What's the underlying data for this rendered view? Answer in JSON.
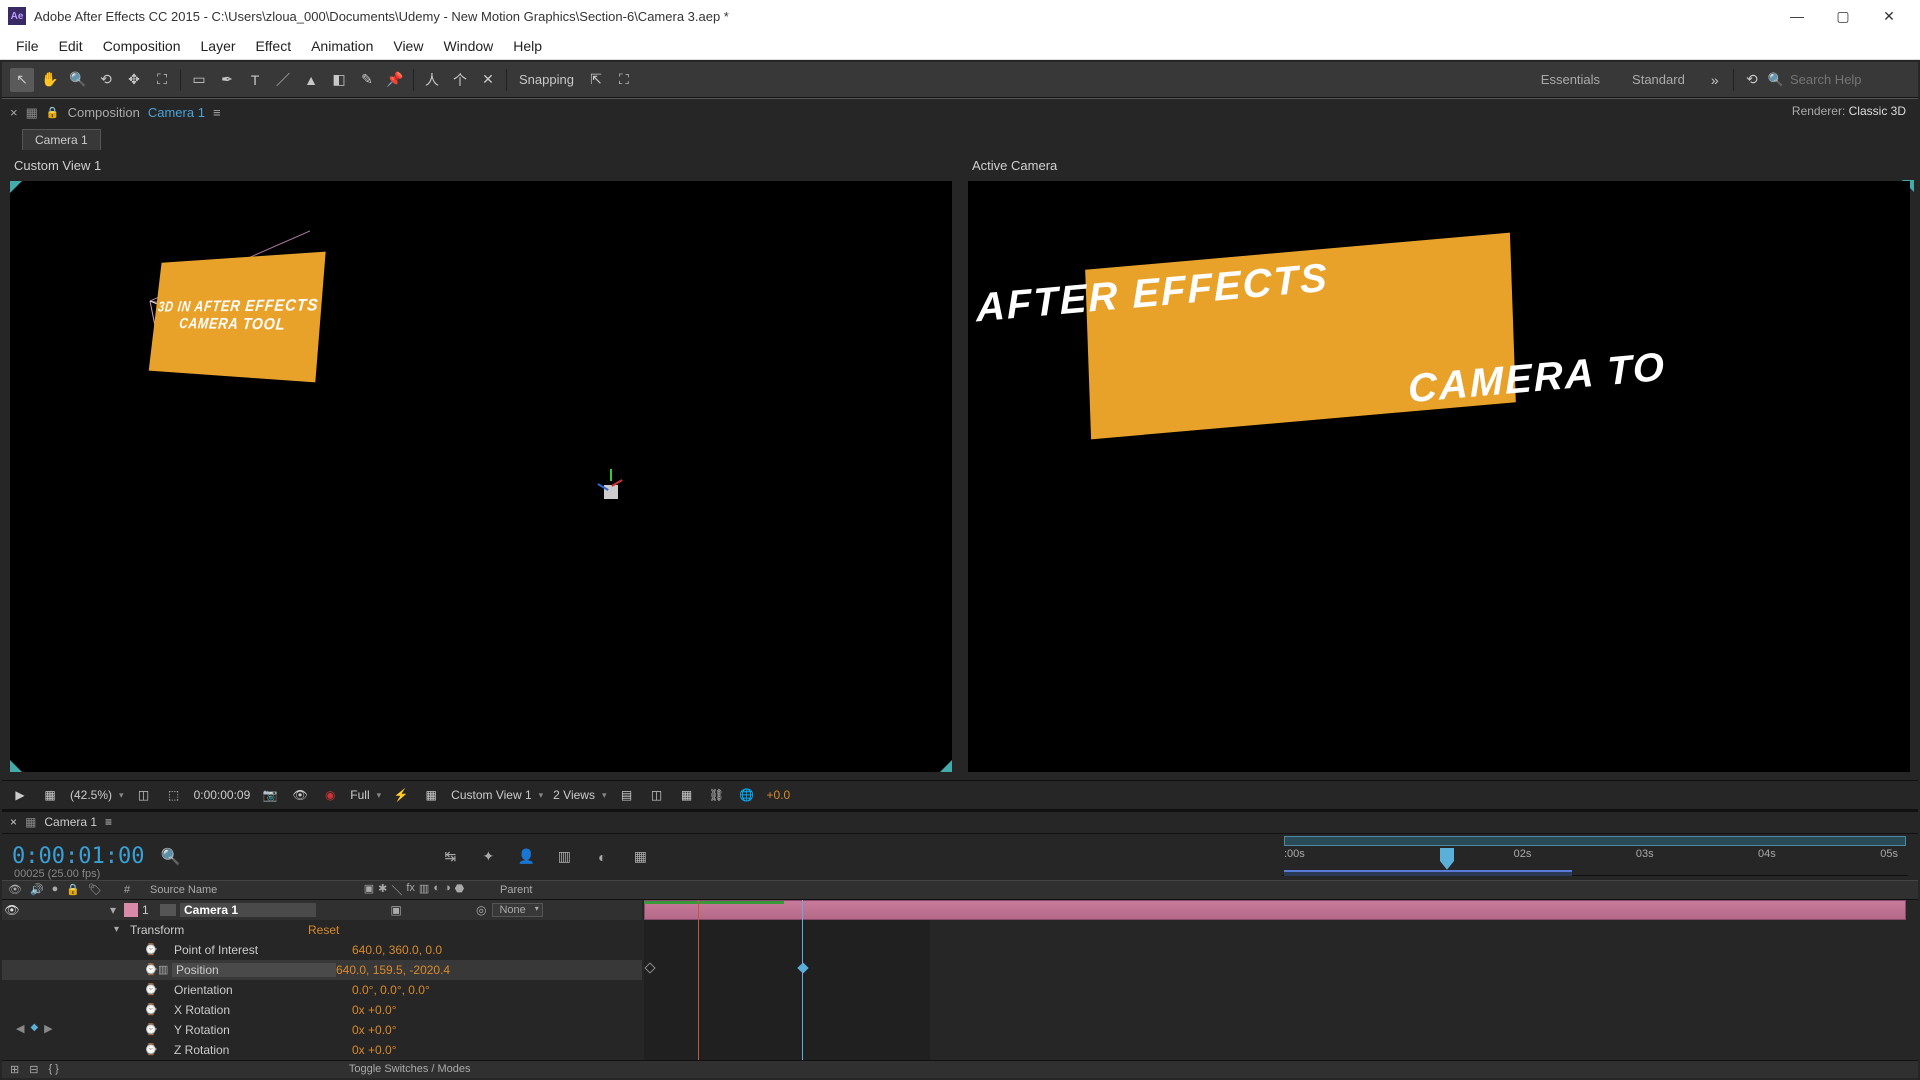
{
  "title": "Adobe After Effects CC 2015 - C:\\Users\\zloua_000\\Documents\\Udemy - New Motion Graphics\\Section-6\\Camera 3.aep *",
  "menu": [
    "File",
    "Edit",
    "Composition",
    "Layer",
    "Effect",
    "Animation",
    "View",
    "Window",
    "Help"
  ],
  "toolbar": {
    "snapping": "Snapping"
  },
  "workspaces": [
    "Essentials",
    "Standard"
  ],
  "search": {
    "placeholder": "Search Help"
  },
  "comp_panel": {
    "label": "Composition",
    "name": "Camera 1",
    "tab": "Camera 1"
  },
  "renderer": {
    "label": "Renderer:",
    "value": "Classic 3D"
  },
  "viewers": {
    "left": {
      "title": "Custom View 1",
      "card_line1": "3D IN AFTER EFFECTS",
      "card_line2": "CAMERA TOOL"
    },
    "right": {
      "title": "Active Camera",
      "text1": "AFTER EFFECTS",
      "text2": "CAMERA TO"
    }
  },
  "viewer_controls": {
    "zoom": "(42.5%)",
    "time": "0:00:00:09",
    "res": "Full",
    "view": "Custom View 1",
    "views": "2 Views",
    "exposure": "+0.0"
  },
  "timeline": {
    "tab": "Camera 1",
    "time": "0:00:01:00",
    "fps": "00025 (25.00 fps)",
    "ruler": [
      ":00s",
      "",
      "02s",
      "03s",
      "04s",
      "05s"
    ],
    "header": {
      "num": "#",
      "source": "Source Name",
      "parent": "Parent"
    },
    "layer": {
      "num": "1",
      "name": "Camera 1",
      "parent_none": "None"
    },
    "transform": "Transform",
    "reset": "Reset",
    "props": [
      {
        "name": "Point of Interest",
        "val": "640.0, 360.0, 0.0",
        "sw": "⌚"
      },
      {
        "name": "Position",
        "val": "640.0, 159.5, -2020.4",
        "sw": "⌚",
        "graph": true,
        "sel": true
      },
      {
        "name": "Orientation",
        "val": "0.0°, 0.0°, 0.0°",
        "sw": "⌚"
      },
      {
        "name": "X Rotation",
        "val": "0x +0.0°",
        "sw": "⌚"
      },
      {
        "name": "Y Rotation",
        "val": "0x +0.0°",
        "sw": "⌚"
      },
      {
        "name": "Z Rotation",
        "val": "0x +0.0°",
        "sw": "⌚"
      }
    ],
    "footer": "Toggle Switches / Modes"
  }
}
